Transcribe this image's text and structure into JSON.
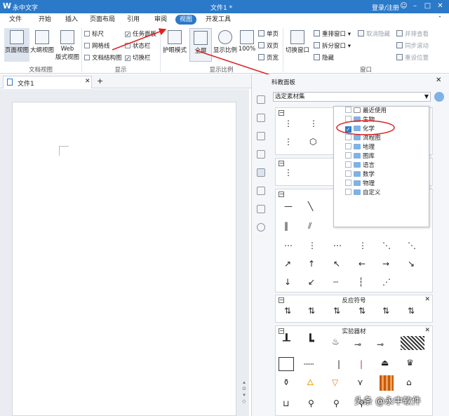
{
  "titlebar": {
    "app_name": "永中文字",
    "doc_title": "文件1 *",
    "login": "登录/注册",
    "bg_color": "#2b79c9"
  },
  "menu": {
    "tabs": [
      "文件",
      "开始",
      "插入",
      "页面布局",
      "引用",
      "审阅",
      "视图",
      "开发工具"
    ],
    "active": "视图"
  },
  "ribbon": {
    "doc_view": {
      "page_view": "页面视图",
      "outline_view": "大纲视图",
      "web_view_1": "Web",
      "web_view_2": "版式视图",
      "group_label": "文档视图"
    },
    "show": {
      "ruler": "标尺",
      "gridlines": "网格线",
      "doc_structure": "文档结构图",
      "task_pane": "任务面板",
      "status_bar": "状态栏",
      "switch_bar": "切换栏",
      "group_label": "显示"
    },
    "zoom": {
      "eye_mode": "护眼模式",
      "fullscreen": "全屏",
      "zoom": "显示比例",
      "zoom_100": "100%",
      "single_page": "单页",
      "double_page": "双页",
      "page_width": "页宽",
      "group_label": "显示比例"
    },
    "window": {
      "switch_window": "切换窗口",
      "arrange_window": "重排窗口",
      "split_window": "拆分窗口",
      "hide": "隐藏",
      "unhide": "取消隐藏",
      "side_by_side": "并排查看",
      "sync_scroll": "同步滚动",
      "reset_position": "重设位置",
      "group_label": "窗口"
    }
  },
  "document": {
    "tab_title": "文件1"
  },
  "panel": {
    "title": "科教面板",
    "select_label": "选定素材集",
    "dropdown_items": [
      {
        "label": "最近使用",
        "checked": false
      },
      {
        "label": "生物",
        "checked": false
      },
      {
        "label": "化学",
        "checked": true
      },
      {
        "label": "流程图",
        "checked": false
      },
      {
        "label": "地理",
        "checked": false
      },
      {
        "label": "图库",
        "checked": false
      },
      {
        "label": "语言",
        "checked": false
      },
      {
        "label": "数学",
        "checked": false
      },
      {
        "label": "物理",
        "checked": false
      },
      {
        "label": "自定义",
        "checked": false
      }
    ],
    "sections": {
      "reaction_symbols": "反应符号",
      "lab_equipment": "实验器材"
    }
  },
  "watermark": "头条 @永中软件"
}
